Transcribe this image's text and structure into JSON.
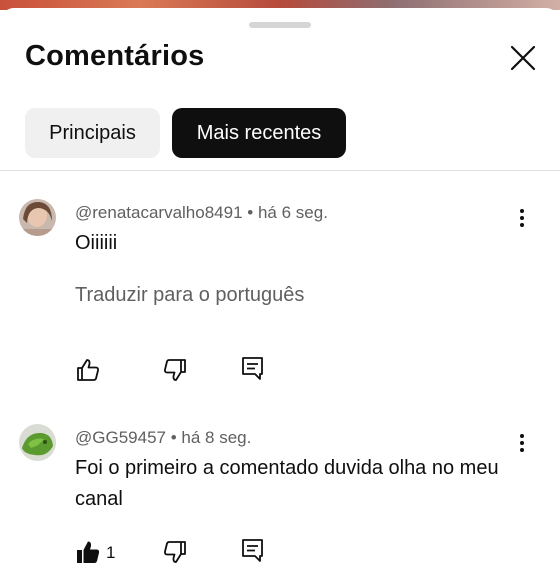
{
  "sheet": {
    "title": "Comentários",
    "filters": [
      "Principais",
      "Mais recentes"
    ],
    "active_filter": "Mais recentes"
  },
  "comments": [
    {
      "author": "@renatacarvalho8491",
      "time": "há 6 seg.",
      "text": "Oiiiiii",
      "translate_label": "Traduzir para o português",
      "likes": "",
      "liked": false
    },
    {
      "author": "@GG59457",
      "time": "há 8 seg.",
      "text": "Foi o primeiro a comentado duvida olha no meu canal",
      "likes": "1",
      "liked": true
    }
  ],
  "icons": {
    "close": "close-icon",
    "more": "more-vert-icon",
    "like": "thumb-up-icon",
    "dislike": "thumb-down-icon",
    "reply": "reply-comment-icon"
  }
}
